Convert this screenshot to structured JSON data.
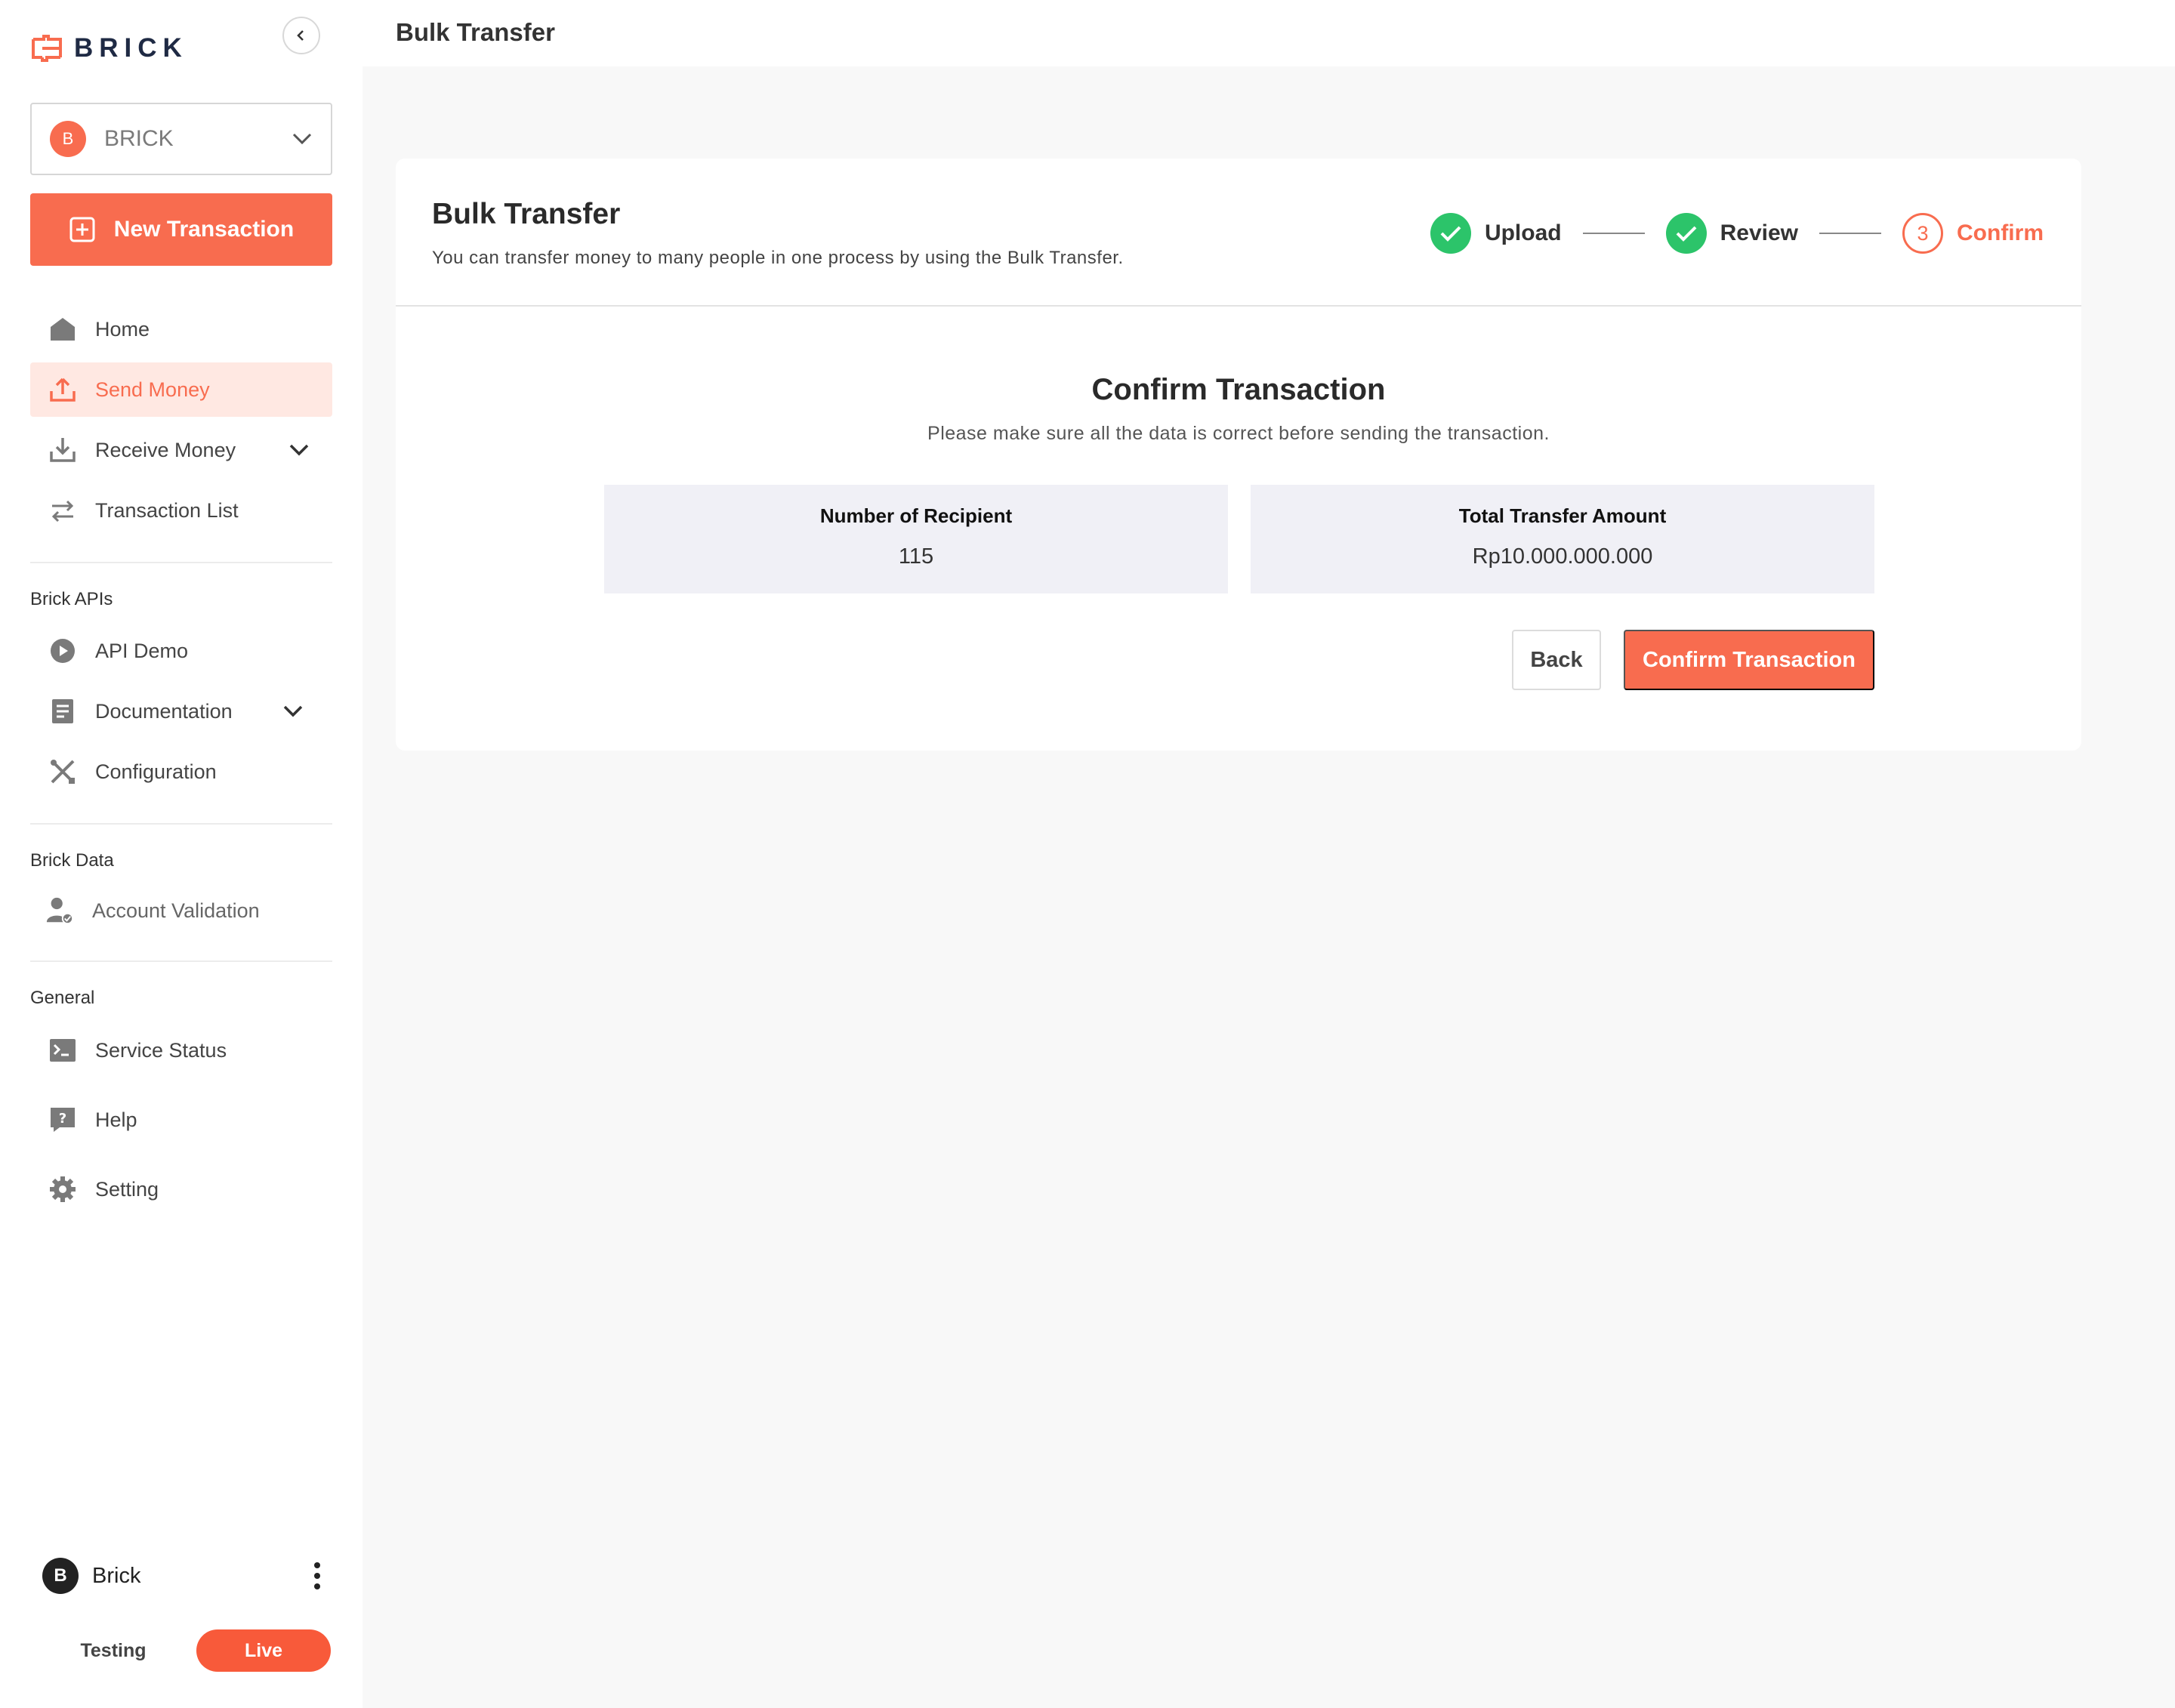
{
  "brand": {
    "name": "BRICK",
    "accent": "#f86c4f"
  },
  "org": {
    "initial": "B",
    "name": "BRICK"
  },
  "sidebar": {
    "new_transaction": "New Transaction",
    "main_items": [
      {
        "label": "Home",
        "icon": "home-icon"
      },
      {
        "label": "Send Money",
        "icon": "upload-icon",
        "active": true
      },
      {
        "label": "Receive Money",
        "icon": "download-icon"
      },
      {
        "label": "Transaction List",
        "icon": "swap-icon"
      }
    ],
    "sections": [
      {
        "label": "Brick APIs",
        "items": [
          {
            "label": "API Demo",
            "icon": "play-icon"
          },
          {
            "label": "Documentation",
            "icon": "document-icon"
          },
          {
            "label": "Configuration",
            "icon": "tools-icon"
          }
        ]
      },
      {
        "label": "Brick Data",
        "items": [
          {
            "label": "Account Validation",
            "icon": "user-check-icon"
          }
        ]
      },
      {
        "label": "General",
        "items": [
          {
            "label": "Service Status",
            "icon": "terminal-icon"
          },
          {
            "label": "Help",
            "icon": "help-icon"
          },
          {
            "label": "Setting",
            "icon": "gear-icon"
          }
        ]
      }
    ],
    "user": {
      "initial": "B",
      "name": "Brick"
    },
    "env": {
      "testing": "Testing",
      "live": "Live"
    }
  },
  "topbar": {
    "title": "Bulk Transfer"
  },
  "card": {
    "title": "Bulk Transfer",
    "subtitle": "You can transfer money to many people in one process by using the Bulk Transfer.",
    "steps": [
      {
        "label": "Upload",
        "state": "done"
      },
      {
        "label": "Review",
        "state": "done"
      },
      {
        "number": "3",
        "label": "Confirm",
        "state": "current"
      }
    ],
    "confirm_title": "Confirm Transaction",
    "confirm_subtitle": "Please make sure all the data is correct before sending the transaction.",
    "summary": {
      "recipients_label": "Number of Recipient",
      "recipients_value": "115",
      "amount_label": "Total Transfer Amount",
      "amount_value": "Rp10.000.000.000"
    },
    "back_label": "Back",
    "confirm_label": "Confirm Transaction"
  }
}
